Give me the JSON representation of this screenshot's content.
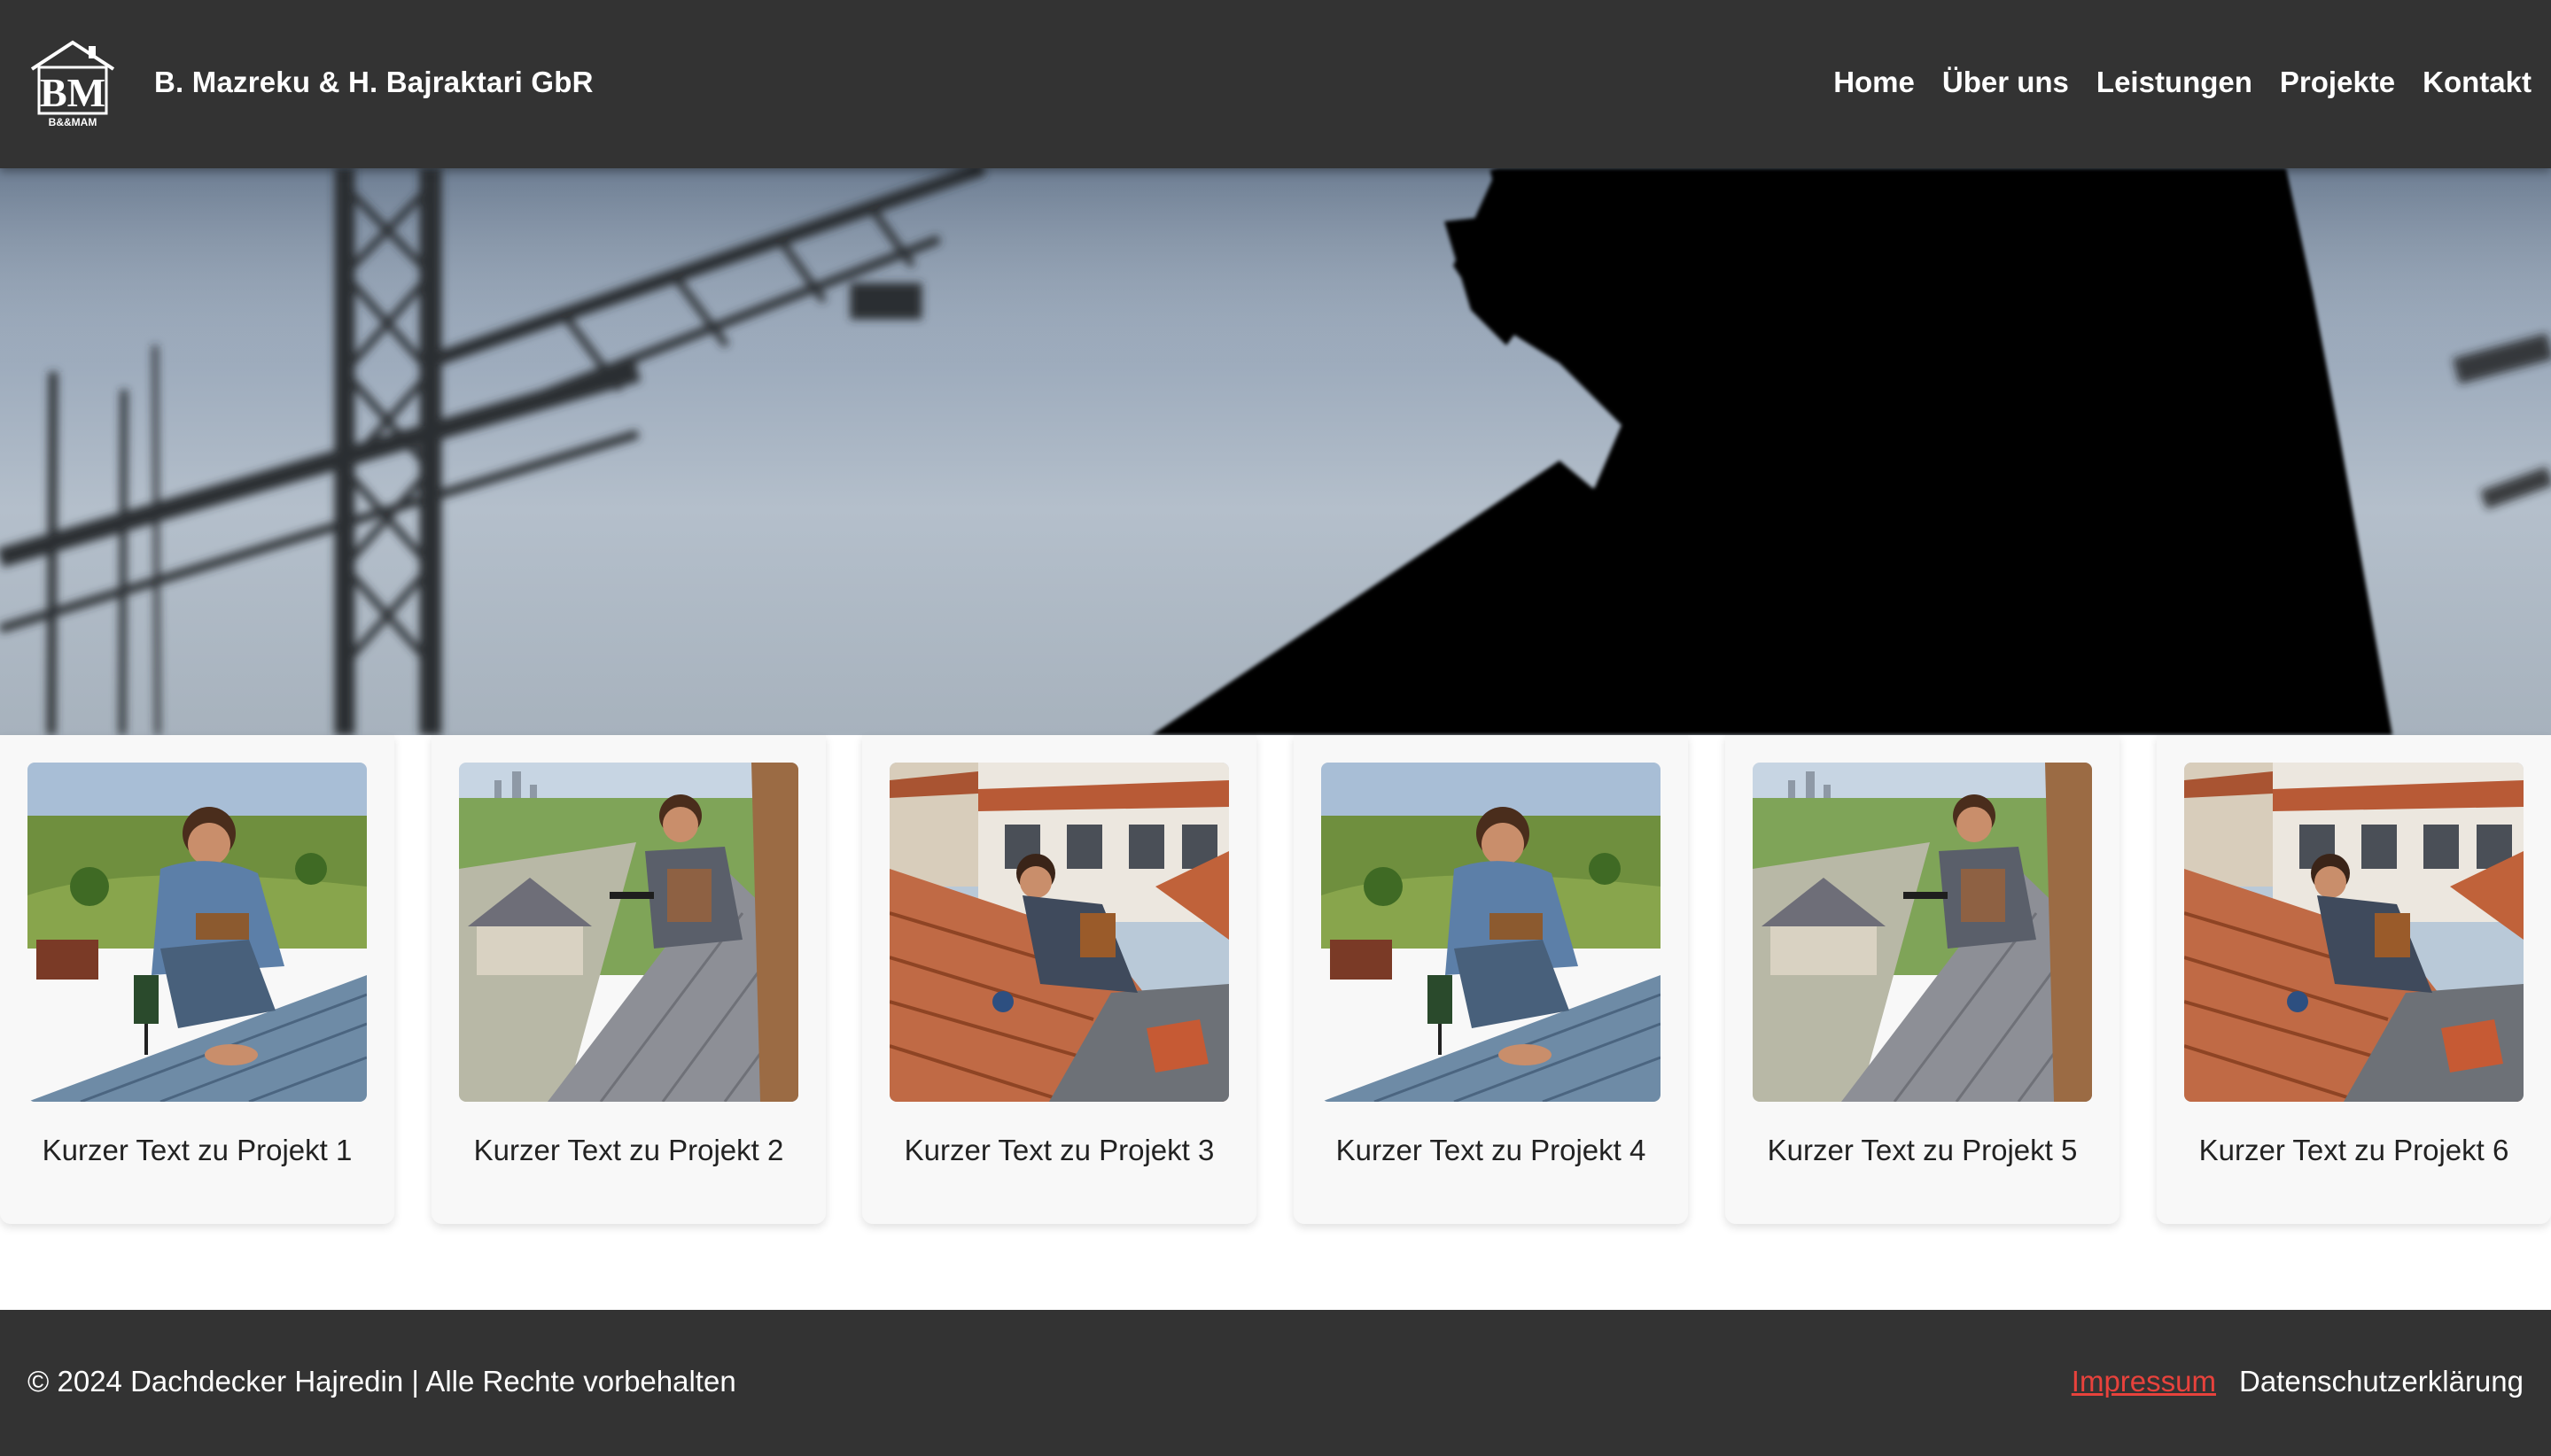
{
  "brand": {
    "name": "B. Mazreku & H. Bajraktari GbR",
    "logo_text": "BM",
    "logo_subtext": "B&&MAM"
  },
  "nav": {
    "items": [
      {
        "label": "Home"
      },
      {
        "label": "Über uns"
      },
      {
        "label": "Leistungen"
      },
      {
        "label": "Projekte"
      },
      {
        "label": "Kontakt"
      }
    ]
  },
  "projects": [
    {
      "text": "Kurzer Text zu Projekt 1",
      "scene": "metal-roof-countryside"
    },
    {
      "text": "Kurzer Text zu Projekt 2",
      "scene": "slate-roof-suburb"
    },
    {
      "text": "Kurzer Text zu Projekt 3",
      "scene": "tile-roof-houses"
    },
    {
      "text": "Kurzer Text zu Projekt 4",
      "scene": "metal-roof-countryside"
    },
    {
      "text": "Kurzer Text zu Projekt 5",
      "scene": "slate-roof-suburb"
    },
    {
      "text": "Kurzer Text zu Projekt 6",
      "scene": "tile-roof-houses"
    }
  ],
  "footer": {
    "copyright": "© 2024 Dachdecker Hajredin | Alle Rechte vorbehalten",
    "links": [
      {
        "label": "Impressum",
        "active": true
      },
      {
        "label": "Datenschutzerklärung",
        "active": false
      }
    ]
  },
  "colors": {
    "header_bg": "#333333",
    "accent_link": "#e8423c",
    "card_bg": "#f8f8f8"
  }
}
